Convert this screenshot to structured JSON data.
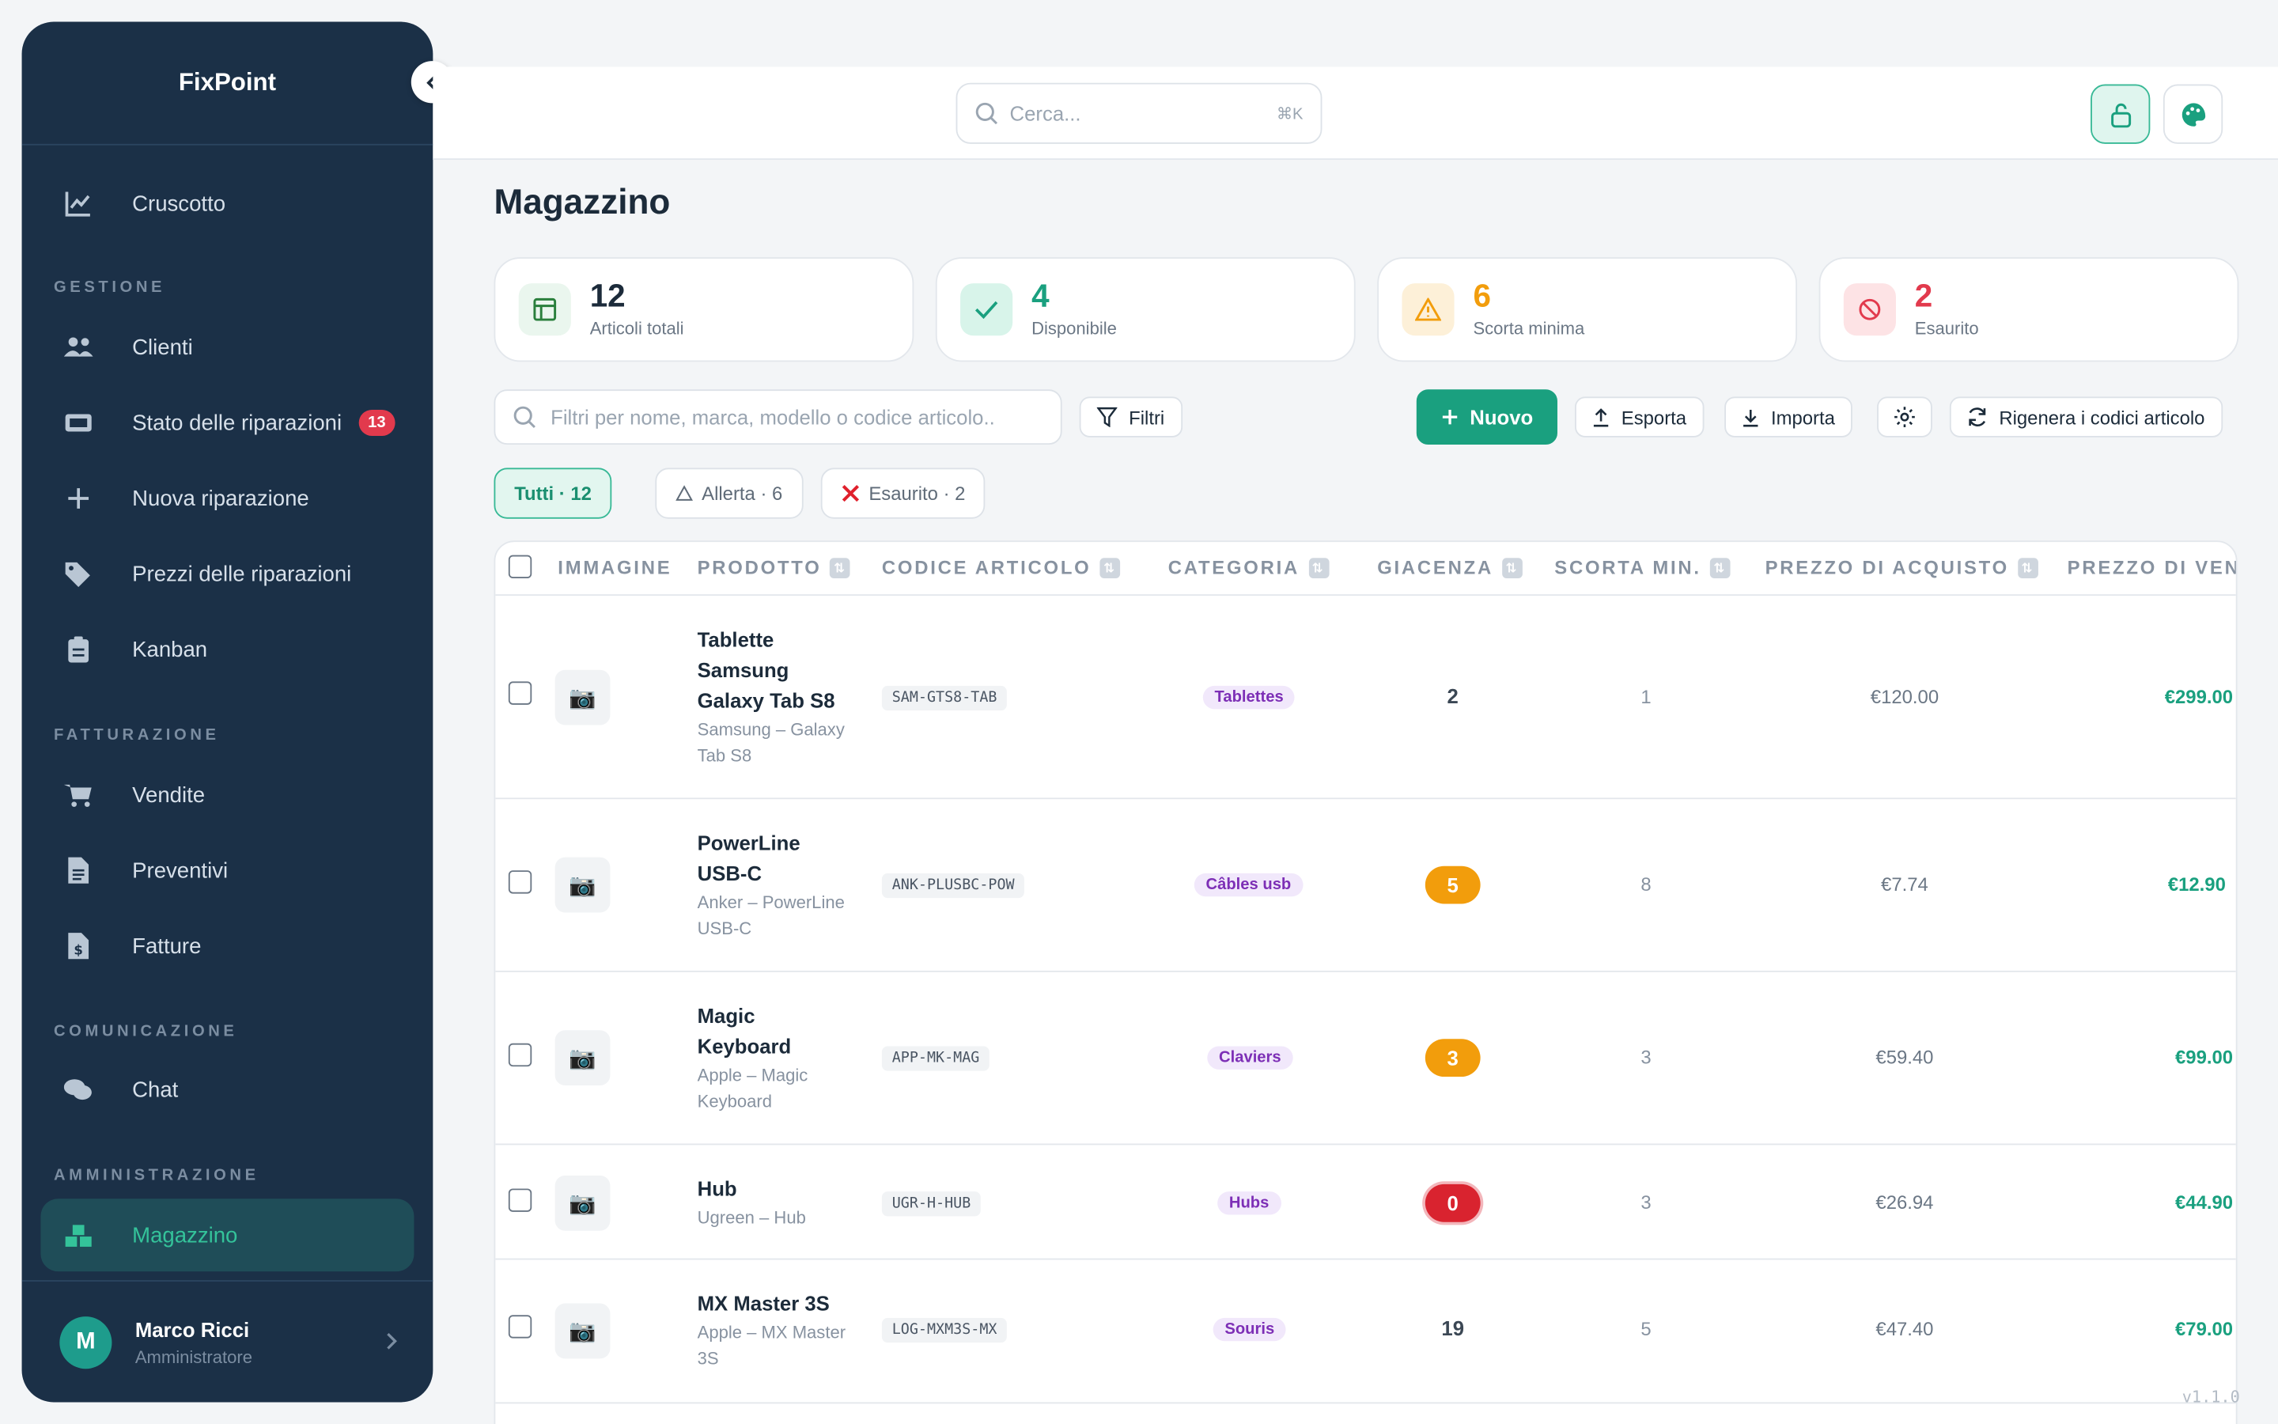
{
  "app": {
    "brand": "FixPoint",
    "version": "v1.1.0"
  },
  "sidebar": {
    "top_item": {
      "label": "Cruscotto",
      "icon": "chart-line-icon"
    },
    "sections": [
      {
        "label": "GESTIONE"
      },
      {
        "label": "FATTURAZIONE"
      },
      {
        "label": "COMUNICAZIONE"
      },
      {
        "label": "AMMINISTRAZIONE"
      }
    ],
    "items": [
      {
        "label": "Clienti",
        "icon": "users-icon"
      },
      {
        "label": "Stato delle riparazioni",
        "icon": "ticket-icon",
        "badge": "13"
      },
      {
        "label": "Nuova riparazione",
        "icon": "plus-icon"
      },
      {
        "label": "Prezzi delle riparazioni",
        "icon": "tags-icon"
      },
      {
        "label": "Kanban",
        "icon": "clipboard-icon"
      },
      {
        "label": "Vendite",
        "icon": "cart-icon"
      },
      {
        "label": "Preventivi",
        "icon": "document-icon"
      },
      {
        "label": "Fatture",
        "icon": "invoice-icon"
      },
      {
        "label": "Chat",
        "icon": "chat-icon"
      },
      {
        "label": "Magazzino",
        "icon": "boxes-icon",
        "active": true
      }
    ],
    "user": {
      "initial": "M",
      "name": "Marco Ricci",
      "role": "Amministratore"
    }
  },
  "header": {
    "search_placeholder": "Cerca...",
    "search_shortcut": "⌘K"
  },
  "main": {
    "title": "Magazzino",
    "stats": [
      {
        "value": "12",
        "label": "Articoli totali",
        "color": "#1c2b3a"
      },
      {
        "value": "4",
        "label": "Disponibile",
        "color": "#1aa07f"
      },
      {
        "value": "6",
        "label": "Scorta minima",
        "color": "#f29d0c"
      },
      {
        "value": "2",
        "label": "Esaurito",
        "color": "#e23a4d"
      }
    ],
    "filter_placeholder": "Filtri per nome, marca, modello o codice articolo..",
    "buttons": {
      "filters": "Filtri",
      "new": "Nuovo",
      "export": "Esporta",
      "import": "Importa",
      "regenerate": "Rigenera i codici articolo"
    },
    "chips": {
      "all": "Tutti · 12",
      "alert": "Allerta · 6",
      "out": "Esaurito · 2"
    },
    "table": {
      "columns": [
        "IMMAGINE",
        "PRODOTTO",
        "CODICE ARTICOLO",
        "CATEGORIA",
        "GIACENZA",
        "SCORTA MIN.",
        "PREZZO DI ACQUISTO",
        "PREZZO DI VEN"
      ],
      "rows": [
        {
          "name_lines": [
            "Tablette",
            "Samsung",
            "Galaxy Tab S8"
          ],
          "sub_lines": [
            "Samsung – Galaxy",
            "Tab S8"
          ],
          "code": "SAM-GTS8-TAB",
          "category": "Tablettes",
          "stock": "2",
          "min": "1",
          "buy": "€120.00",
          "sell": "€299.00",
          "status": "ok"
        },
        {
          "name_lines": [
            "PowerLine",
            "USB-C"
          ],
          "sub_lines": [
            "Anker – PowerLine",
            "USB-C"
          ],
          "code": "ANK-PLUSBC-POW",
          "category": "Câbles usb",
          "stock": "5",
          "min": "8",
          "buy": "€7.74",
          "sell": "€12.90",
          "status": "warn"
        },
        {
          "name_lines": [
            "Magic",
            "Keyboard"
          ],
          "sub_lines": [
            "Apple – Magic",
            "Keyboard"
          ],
          "code": "APP-MK-MAG",
          "category": "Claviers",
          "stock": "3",
          "min": "3",
          "buy": "€59.40",
          "sell": "€99.00",
          "status": "warn"
        },
        {
          "name_lines": [
            "Hub"
          ],
          "sub_lines": [
            "Ugreen – Hub"
          ],
          "code": "UGR-H-HUB",
          "category": "Hubs",
          "stock": "0",
          "min": "3",
          "buy": "€26.94",
          "sell": "€44.90",
          "status": "zero"
        },
        {
          "name_lines": [
            "MX Master 3S"
          ],
          "sub_lines": [
            "Apple – MX Master",
            "3S"
          ],
          "code": "LOG-MXM3S-MX",
          "category": "Souris",
          "stock": "19",
          "min": "5",
          "buy": "€47.40",
          "sell": "€79.00",
          "status": "ok"
        }
      ]
    }
  }
}
